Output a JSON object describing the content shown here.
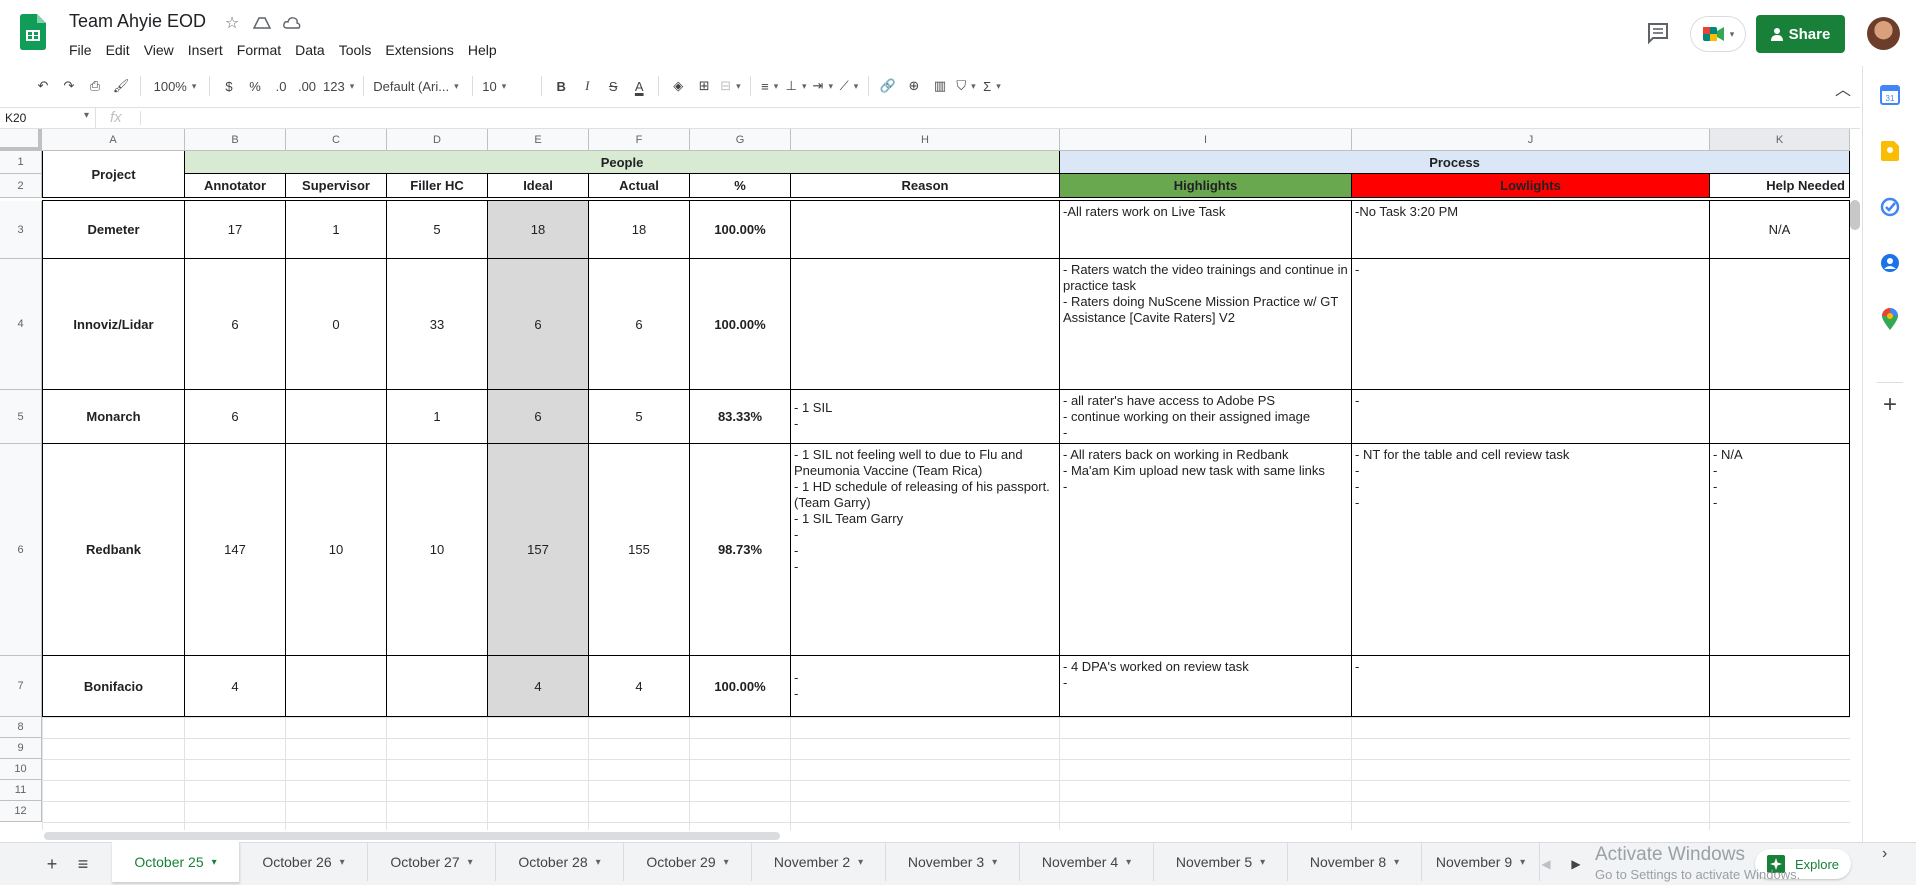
{
  "app": {
    "title": "Team Ahyie EOD",
    "menu": [
      "File",
      "Edit",
      "View",
      "Insert",
      "Format",
      "Data",
      "Tools",
      "Extensions",
      "Help"
    ],
    "share_label": "Share",
    "explore_label": "Explore"
  },
  "toolbar": {
    "zoom": "100%",
    "currency": "$",
    "percent": "%",
    "decrease_decimals": ".0",
    "increase_decimals": ".00",
    "more_formats": "123",
    "font": "Default (Ari...",
    "font_size": "10"
  },
  "formula_bar": {
    "cell_ref": "K20",
    "fx": "fx",
    "value": ""
  },
  "columns": [
    "A",
    "B",
    "C",
    "D",
    "E",
    "F",
    "G",
    "H",
    "I",
    "J",
    "K"
  ],
  "rows": [
    "1",
    "2",
    "3",
    "4",
    "5",
    "6",
    "7",
    "8",
    "9",
    "10",
    "11",
    "12"
  ],
  "header": {
    "project": "Project",
    "people": "People",
    "process": "Process",
    "annotator": "Annotator",
    "supervisor": "Supervisor",
    "filler_hc": "Filler HC",
    "ideal": "Ideal",
    "actual": "Actual",
    "pct": "%",
    "reason": "Reason",
    "highlights": "Highlights",
    "lowlights": "Lowlights",
    "help_needed": "Help Needed"
  },
  "records": [
    {
      "project": "Demeter",
      "annotator": "17",
      "supervisor": "1",
      "filler_hc": "5",
      "ideal": "18",
      "actual": "18",
      "pct": "100.00%",
      "reason": "",
      "highlights": "-All raters work on Live Task",
      "lowlights": "-No Task 3:20 PM",
      "help": "N/A"
    },
    {
      "project": "Innoviz/Lidar",
      "annotator": "6",
      "supervisor": "0",
      "filler_hc": "33",
      "ideal": "6",
      "actual": "6",
      "pct": "100.00%",
      "reason": "",
      "highlights": "- Raters watch the video trainings and continue in practice task\n- Raters doing NuScene Mission Practice w/ GT Assistance [Cavite Raters] V2",
      "lowlights": "-",
      "help": ""
    },
    {
      "project": "Monarch",
      "annotator": "6",
      "supervisor": "",
      "filler_hc": "1",
      "ideal": "6",
      "actual": "5",
      "pct": "83.33%",
      "reason": "- 1 SIL\n-",
      "highlights": "- all rater's have access to Adobe PS\n- continue working on their assigned image\n-",
      "lowlights": "-",
      "help": ""
    },
    {
      "project": "Redbank",
      "annotator": "147",
      "supervisor": "10",
      "filler_hc": "10",
      "ideal": "157",
      "actual": "155",
      "pct": "98.73%",
      "reason": "-  1 SIL not feeling well to due to Flu and Pneumonia Vaccine (Team Rica)\n- 1 HD schedule of releasing of his passport. (Team Garry)\n- 1 SIL Team Garry\n-\n-\n-",
      "highlights": "- All raters back on working in Redbank\n- Ma'am Kim upload new task with same links\n-",
      "lowlights": "- NT for the table and cell review task\n-\n-\n-",
      "help": "- N/A\n-\n-\n-"
    },
    {
      "project": "Bonifacio",
      "annotator": "4",
      "supervisor": "",
      "filler_hc": "",
      "ideal": "4",
      "actual": "4",
      "pct": "100.00%",
      "reason": "-\n-",
      "highlights": "- 4 DPA's worked on review task\n-",
      "lowlights": "-",
      "help": ""
    }
  ],
  "tabs": [
    "October 25",
    "October 26",
    "October 27",
    "October 28",
    "October 29",
    "November 2",
    "November 3",
    "November 4",
    "November 5",
    "November 8",
    "November 9"
  ],
  "active_tab": "October 25",
  "watermark": {
    "title": "Activate Windows",
    "subtitle": "Go to Settings to activate Windows."
  },
  "colors": {
    "people_header_bg": "#d9ead3",
    "process_header_bg": "#dbe7f6",
    "highlights_bg": "#6aa84f",
    "lowlights_bg": "#ff0000",
    "ideal_bg": "#d9d9d9",
    "share_bg": "#188038"
  },
  "icons": [
    "sheets-logo",
    "star-icon",
    "move-to-drive-icon",
    "cloud-saved-icon",
    "comment-icon",
    "meet-icon",
    "calendar-icon",
    "keep-icon",
    "tasks-icon",
    "contacts-icon",
    "maps-icon",
    "add-icon"
  ]
}
